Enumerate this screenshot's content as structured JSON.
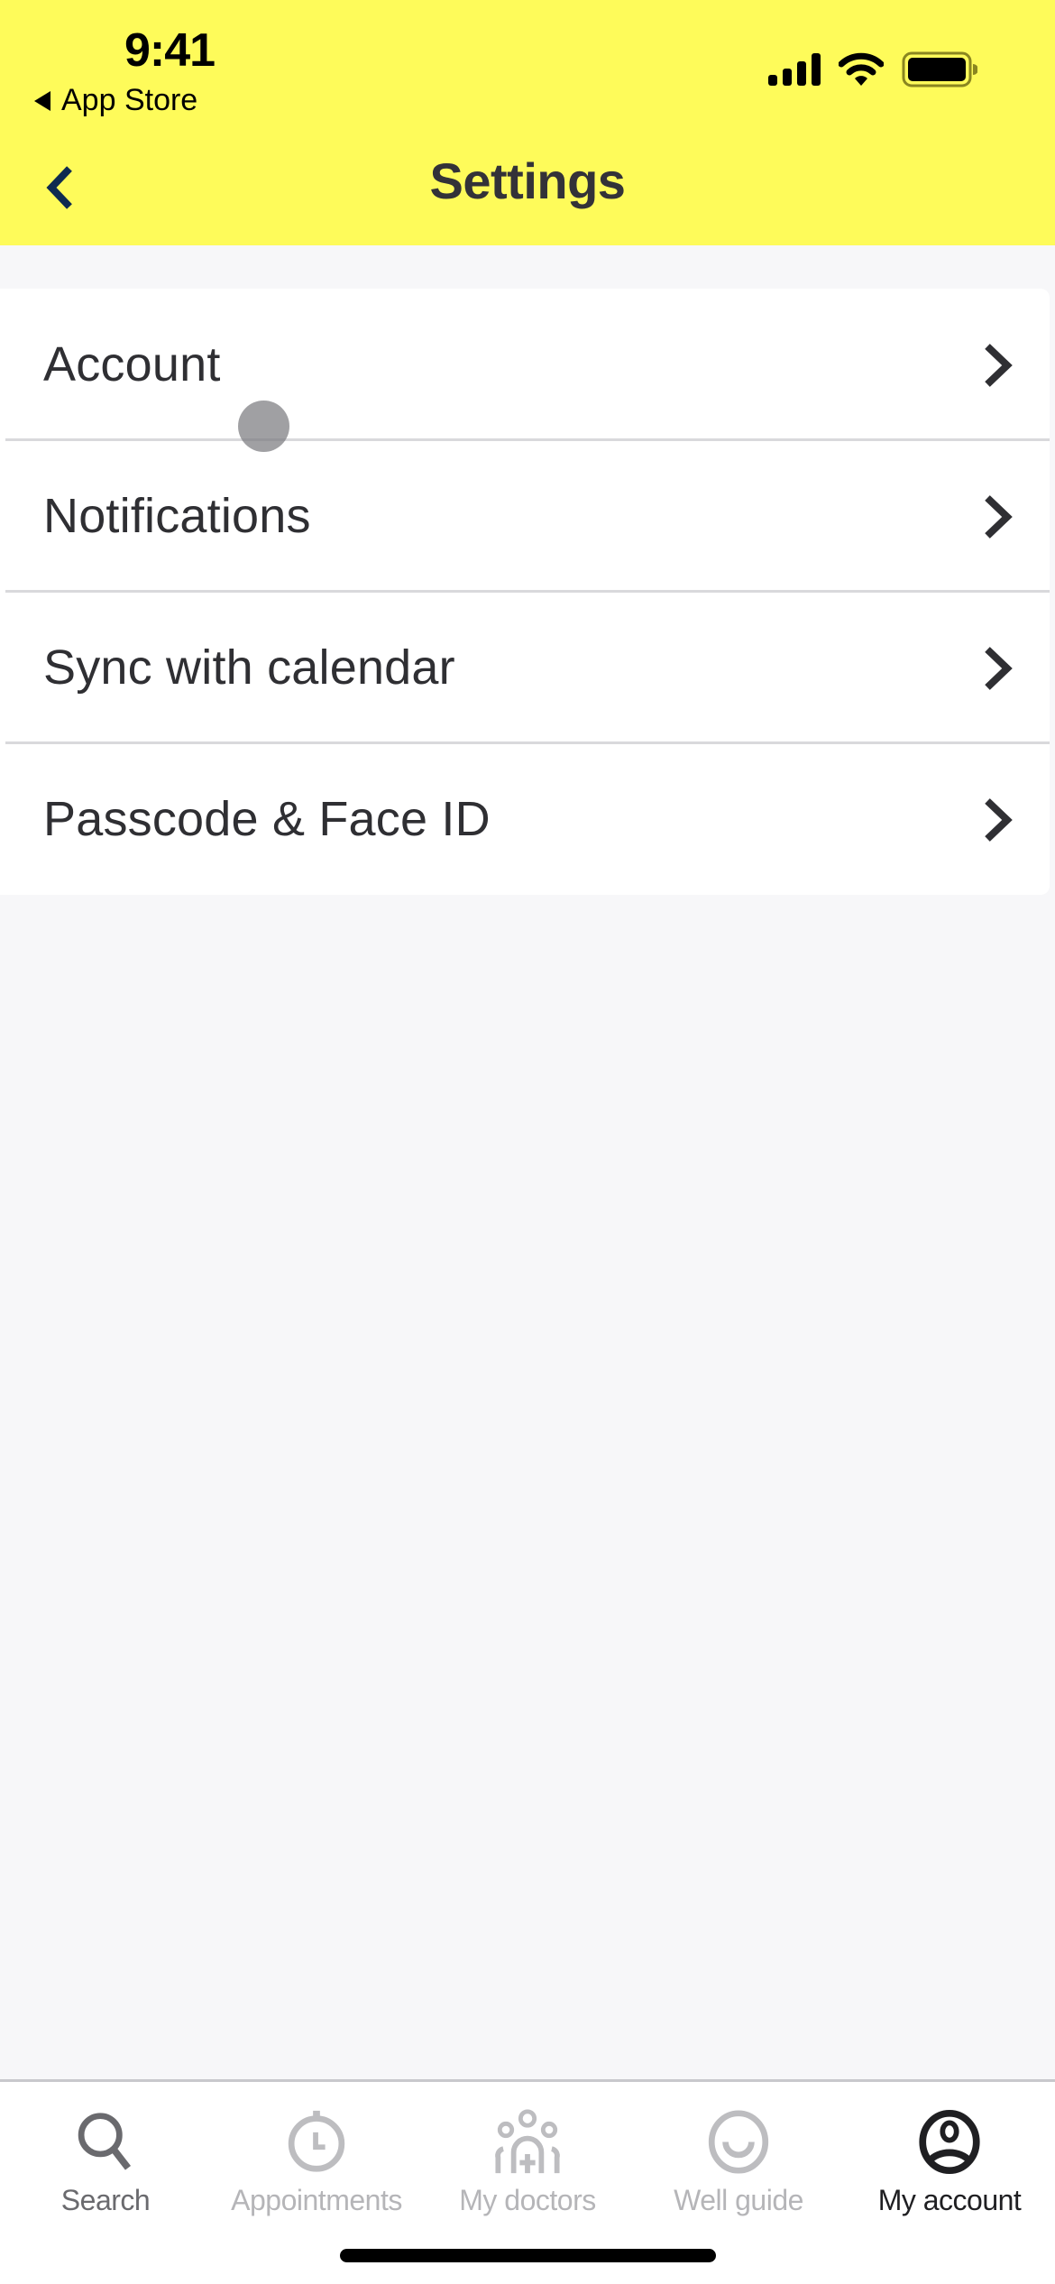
{
  "status_bar": {
    "time": "9:41",
    "back_app": "App Store",
    "icons": [
      "cellular-signal-icon",
      "wifi-icon",
      "battery-icon"
    ]
  },
  "header": {
    "title": "Settings",
    "back_icon": "chevron-left-icon"
  },
  "settings": {
    "items": [
      {
        "label": "Account",
        "icon": "chevron-right-icon"
      },
      {
        "label": "Notifications",
        "icon": "chevron-right-icon"
      },
      {
        "label": "Sync with calendar",
        "icon": "chevron-right-icon"
      },
      {
        "label": "Passcode & Face ID",
        "icon": "chevron-right-icon"
      }
    ]
  },
  "tabbar": {
    "items": [
      {
        "label": "Search",
        "icon": "search-icon",
        "state": "default"
      },
      {
        "label": "Appointments",
        "icon": "stopwatch-icon",
        "state": "inactive"
      },
      {
        "label": "My doctors",
        "icon": "doctors-group-icon",
        "state": "inactive"
      },
      {
        "label": "Well guide",
        "icon": "smile-icon",
        "state": "inactive"
      },
      {
        "label": "My account",
        "icon": "user-circle-icon",
        "state": "active"
      }
    ]
  },
  "colors": {
    "header_bg": "#fefb5a",
    "back_icon": "#0f2b50",
    "text_primary": "#2f2f33",
    "tab_inactive": "#b5b5b8",
    "tab_active": "#1f1f22"
  }
}
